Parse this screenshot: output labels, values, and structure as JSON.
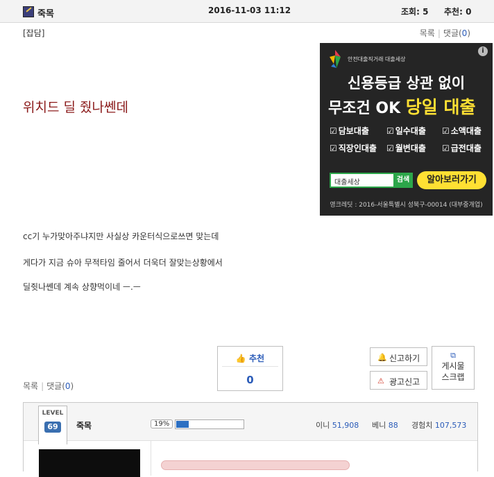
{
  "header": {
    "author": "죽목",
    "datetime": "2016-11-03 11:12",
    "views_label": "조회:",
    "views_value": "5",
    "recommend_label": "추천:",
    "recommend_value": "0"
  },
  "category": "[잡담]",
  "nav": {
    "list_label": "목록",
    "comments_label": "댓글(",
    "comments_count": "0",
    "comments_close": ")"
  },
  "post": {
    "title": "위치드 딜 줬나쎈데",
    "lines": [
      "cc기 누가맞아주냐지만 사실상 카운터식으로쓰면 맞는데",
      "게다가 지금 슈아 무적타임 줄어서 더욱더 잘맞는상황에서",
      "딜쥣나쎈데 계속 상향먹이네 ㅡ.ㅡ"
    ]
  },
  "ad": {
    "info": "i",
    "brand": "안전대출직거래 대출세상",
    "headline1": "신용등급 상관 없이",
    "headline2_prefix": "무조건 OK ",
    "headline2_highlight": "당일 대출",
    "items": [
      "담보대출",
      "일수대출",
      "소액대출",
      "직장인대출",
      "월변대출",
      "급전대출"
    ],
    "search_value": "대출세상",
    "search_button": "검색",
    "cta": "알아보러가기",
    "footer": "영크레딧 : 2016-서울특별시 성북구-00014 (대부중개업)",
    "accent_green": "#2ca64a",
    "accent_yellow": "#ffe033"
  },
  "vote": {
    "label": "추천",
    "icon": "thumbs-up-icon",
    "count": "0"
  },
  "buttons": {
    "report": "신고하기",
    "report_icon": "bell-icon",
    "ad_report": "광고신고",
    "ad_report_icon": "warning-icon",
    "scrap_line1": "게시물",
    "scrap_line2": "스크랩",
    "scrap_icon": "scrap-icon"
  },
  "profile": {
    "level_label": "LEVEL",
    "level": "69",
    "name": "죽목",
    "progress_text": "19%",
    "progress": 0.19,
    "money_label": "이니",
    "money_value": "51,908",
    "beni_label": "베니",
    "beni_value": "88",
    "exp_label": "경험치",
    "exp_value": "107,573"
  },
  "colors": {
    "title": "#8b1a1a",
    "link_blue": "#2a5bb8",
    "progress_fill": "#2c6fc2"
  }
}
